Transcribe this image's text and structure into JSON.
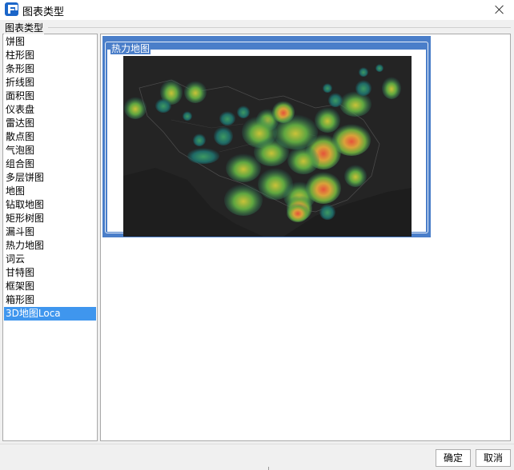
{
  "window": {
    "title": "图表类型",
    "accent_color": "#1b66c9"
  },
  "section": {
    "label": "图表类型"
  },
  "chart_types": [
    {
      "label": "饼图"
    },
    {
      "label": "柱形图"
    },
    {
      "label": "条形图"
    },
    {
      "label": "折线图"
    },
    {
      "label": "面积图"
    },
    {
      "label": "仪表盘"
    },
    {
      "label": "雷达图"
    },
    {
      "label": "散点图"
    },
    {
      "label": "气泡图"
    },
    {
      "label": "组合图"
    },
    {
      "label": "多层饼图"
    },
    {
      "label": "地图"
    },
    {
      "label": "钻取地图"
    },
    {
      "label": "矩形树图"
    },
    {
      "label": "漏斗图"
    },
    {
      "label": "热力地图"
    },
    {
      "label": "词云"
    },
    {
      "label": "甘特图"
    },
    {
      "label": "框架图"
    },
    {
      "label": "箱形图"
    },
    {
      "label": "3D地图Loca",
      "selected": true
    }
  ],
  "preview": {
    "title": "热力地图",
    "card_color": "#4a7ec9",
    "selection_color": "#3f96ee"
  },
  "buttons": {
    "ok": "确定",
    "cancel": "取消"
  }
}
